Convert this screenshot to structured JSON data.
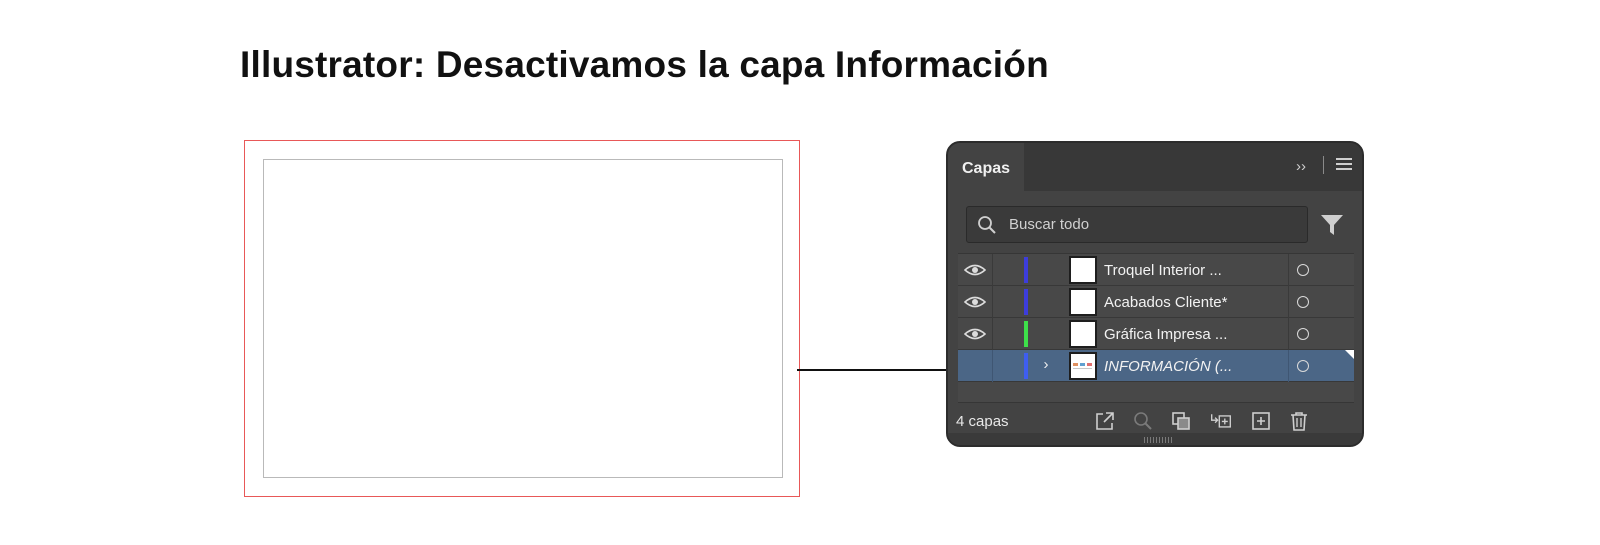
{
  "page": {
    "title": "Illustrator: Desactivamos la capa Información"
  },
  "panel": {
    "tab_label": "Capas",
    "search": {
      "placeholder": "Buscar todo",
      "value": ""
    },
    "layers": [
      {
        "name": "Troquel Interior ...",
        "visible": true,
        "color": "#3d3ddc",
        "selected": false,
        "expandable": false
      },
      {
        "name": "Acabados Cliente*",
        "visible": true,
        "color": "#3d3ddc",
        "selected": false,
        "expandable": false
      },
      {
        "name": "Gráfica Impresa ...",
        "visible": true,
        "color": "#3ee04a",
        "selected": false,
        "expandable": false
      },
      {
        "name": "INFORMACIÓN (...",
        "visible": false,
        "color": "#3e5ef0",
        "selected": true,
        "expandable": true
      }
    ],
    "layer_count": "4 capas",
    "colors": {
      "panel_bg": "#434343",
      "selected_row": "#4b6686"
    }
  },
  "icons": {
    "collapse": "double-chevron-right-icon",
    "menu": "hamburger-menu-icon",
    "search": "search-icon",
    "filter": "filter-icon",
    "eye": "eye-icon",
    "expand": "chevron-right-icon",
    "target": "target-circle-icon",
    "footer": [
      "export-icon",
      "locate-object-icon",
      "make-clipping-mask-icon",
      "create-sublayer-icon",
      "new-layer-icon",
      "trash-icon"
    ]
  }
}
